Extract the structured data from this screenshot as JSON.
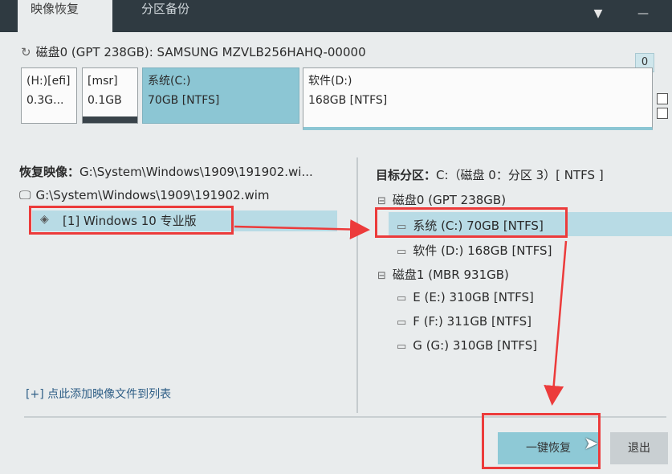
{
  "tabs": {
    "restore_label": "映像恢复",
    "backup_label": "分区备份"
  },
  "title_icons": {
    "dropdown": "▼",
    "minimize": "—"
  },
  "disk": {
    "title": "磁盘0 (GPT 238GB): SAMSUNG MZVLB256HAHQ-00000",
    "badge": "0",
    "partitions": [
      {
        "name": "(H:)[efi]",
        "size": "0.3G..."
      },
      {
        "name": "[msr]",
        "size": "0.1GB"
      },
      {
        "name": "系统(C:)",
        "size": "70GB [NTFS]"
      },
      {
        "name": "软件(D:)",
        "size": "168GB [NTFS]"
      }
    ]
  },
  "left_panel": {
    "label": "恢复映像：",
    "path_short": "G:\\System\\Windows\\1909\\191902.wi...",
    "tree_root": "G:\\System\\Windows\\1909\\191902.wim",
    "image_item": "[1] Windows 10 专业版",
    "add_link": "[+] 点此添加映像文件到列表"
  },
  "right_panel": {
    "label": "目标分区：",
    "target_text": "C:（磁盘 0：分区 3）[ NTFS ]",
    "disk0": "磁盘0 (GPT 238GB)",
    "disk0_parts": [
      "系统 (C:) 70GB [NTFS]",
      "软件 (D:) 168GB [NTFS]"
    ],
    "disk1": "磁盘1 (MBR 931GB)",
    "disk1_parts": [
      "E (E:) 310GB [NTFS]",
      "F (F:) 311GB [NTFS]",
      "G (G:) 310GB [NTFS]"
    ]
  },
  "buttons": {
    "restore": "一键恢复",
    "exit": "退出"
  },
  "icons": {
    "refresh": "refresh-icon",
    "monitor": "monitor-icon",
    "layers": "layers-icon",
    "disk": "disk-icon",
    "folder": "folder-icon",
    "cursor": "cursor-icon"
  },
  "colors": {
    "accent": "#8ec9d6",
    "selection": "#b8dbe5",
    "annotation": "#ec3b3b",
    "titlebar": "#2f3a41"
  }
}
